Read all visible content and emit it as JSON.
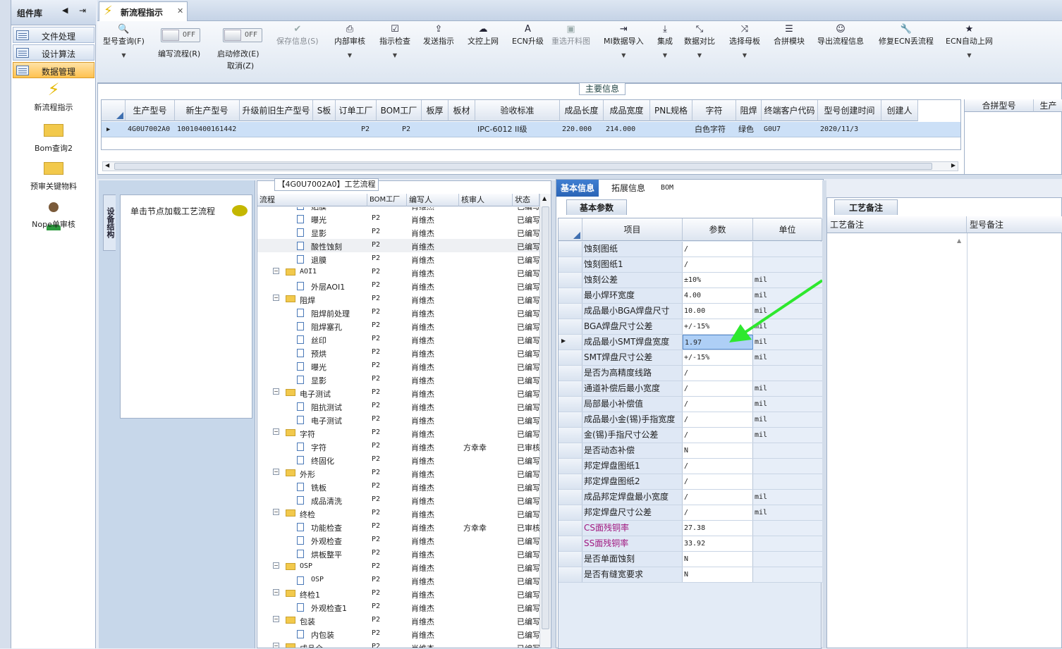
{
  "sidebar": {
    "title": "组件库",
    "groups": [
      "文件处理",
      "设计算法",
      "数据管理"
    ],
    "tools": [
      "新流程指示",
      "Bom查询2",
      "预审关键物料",
      "Nope单审核"
    ]
  },
  "doc_tab": {
    "title": "新流程指示"
  },
  "ribbon": {
    "model_query": "型号查询(F)",
    "toggle1_state": "OFF",
    "toggle1_label": "编写流程(R)",
    "toggle2_state": "OFF",
    "toggle2_label": "启动修改(E)",
    "cancel_label": "取消(Z)",
    "buttons": [
      "保存信息(S)",
      "内部审核",
      "指示检查",
      "发送指示",
      "文控上网",
      "ECN升级",
      "重选开料图",
      "MI数据导入",
      "集成",
      "数据对比",
      "选择母板",
      "合拼模块",
      "导出流程信息",
      "修复ECN丢流程",
      "ECN自动上网"
    ]
  },
  "main_info": {
    "caption": "主要信息",
    "columns": [
      "生产型号",
      "新生产型号",
      "升级前旧生产型号",
      "S板",
      "订单工厂",
      "BOM工厂",
      "板厚",
      "板材",
      "验收标准",
      "成品长度",
      "成品宽度",
      "PNL规格",
      "字符",
      "阻焊",
      "终端客户代码",
      "型号创建时间",
      "创建人"
    ],
    "row": {
      "生产型号": "4G0U7002A0",
      "新生产型号": "10010400161442",
      "订单工厂": "P2",
      "BOM工厂": "P2",
      "验收标准": "IPC-6012 II级",
      "成品长度": "220.000",
      "成品宽度": "214.000",
      "字符": "白色字符",
      "阻焊": "绿色",
      "终端客户代码": "G0U7",
      "型号创建时间": "2020/11/3"
    },
    "side_columns": [
      "合拼型号",
      "生产"
    ]
  },
  "tree_panel": {
    "vtab": "设备结构",
    "hint": "单击节点加载工艺流程"
  },
  "process": {
    "caption": "【4G0U7002A0】工艺流程",
    "columns": [
      "流程",
      "BOM工厂",
      "编写人",
      "核审人",
      "状态"
    ],
    "rows": [
      {
        "n": "贴膜",
        "t": "doc",
        "f": "P2",
        "w": "肖维杰",
        "r": "",
        "s": "已编写"
      },
      {
        "n": "曝光",
        "t": "doc",
        "f": "P2",
        "w": "肖维杰",
        "r": "",
        "s": "已编写"
      },
      {
        "n": "显影",
        "t": "doc",
        "f": "P2",
        "w": "肖维杰",
        "r": "",
        "s": "已编写"
      },
      {
        "n": "酸性蚀刻",
        "t": "doc",
        "f": "P2",
        "w": "肖维杰",
        "r": "",
        "s": "已编写"
      },
      {
        "n": "退膜",
        "t": "doc",
        "f": "P2",
        "w": "肖维杰",
        "r": "",
        "s": "已编写"
      },
      {
        "n": "AOI1",
        "t": "fold",
        "f": "P2",
        "w": "肖维杰",
        "r": "",
        "s": "已编写"
      },
      {
        "n": "外层AOI1",
        "t": "doc",
        "f": "P2",
        "w": "肖维杰",
        "r": "",
        "s": "已编写"
      },
      {
        "n": "阻焊",
        "t": "fold",
        "f": "P2",
        "w": "肖维杰",
        "r": "",
        "s": "已编写"
      },
      {
        "n": "阻焊前处理",
        "t": "doc",
        "f": "P2",
        "w": "肖维杰",
        "r": "",
        "s": "已编写"
      },
      {
        "n": "阻焊塞孔",
        "t": "doc",
        "f": "P2",
        "w": "肖维杰",
        "r": "",
        "s": "已编写"
      },
      {
        "n": "丝印",
        "t": "doc",
        "f": "P2",
        "w": "肖维杰",
        "r": "",
        "s": "已编写"
      },
      {
        "n": "预烘",
        "t": "doc",
        "f": "P2",
        "w": "肖维杰",
        "r": "",
        "s": "已编写"
      },
      {
        "n": "曝光",
        "t": "doc",
        "f": "P2",
        "w": "肖维杰",
        "r": "",
        "s": "已编写"
      },
      {
        "n": "显影",
        "t": "doc",
        "f": "P2",
        "w": "肖维杰",
        "r": "",
        "s": "已编写"
      },
      {
        "n": "电子测试",
        "t": "fold",
        "f": "P2",
        "w": "肖维杰",
        "r": "",
        "s": "已编写"
      },
      {
        "n": "阻抗测试",
        "t": "doc",
        "f": "P2",
        "w": "肖维杰",
        "r": "",
        "s": "已编写"
      },
      {
        "n": "电子测试",
        "t": "doc",
        "f": "P2",
        "w": "肖维杰",
        "r": "",
        "s": "已编写"
      },
      {
        "n": "字符",
        "t": "fold",
        "f": "P2",
        "w": "肖维杰",
        "r": "",
        "s": "已编写"
      },
      {
        "n": "字符",
        "t": "doc",
        "f": "P2",
        "w": "肖维杰",
        "r": "方幸幸",
        "s": "已审核"
      },
      {
        "n": "终固化",
        "t": "doc",
        "f": "P2",
        "w": "肖维杰",
        "r": "",
        "s": "已编写"
      },
      {
        "n": "外形",
        "t": "fold",
        "f": "P2",
        "w": "肖维杰",
        "r": "",
        "s": "已编写"
      },
      {
        "n": "铣板",
        "t": "doc",
        "f": "P2",
        "w": "肖维杰",
        "r": "",
        "s": "已编写"
      },
      {
        "n": "成品清洗",
        "t": "doc",
        "f": "P2",
        "w": "肖维杰",
        "r": "",
        "s": "已编写"
      },
      {
        "n": "终检",
        "t": "fold",
        "f": "P2",
        "w": "肖维杰",
        "r": "",
        "s": "已编写"
      },
      {
        "n": "功能检查",
        "t": "doc",
        "f": "P2",
        "w": "肖维杰",
        "r": "方幸幸",
        "s": "已审核"
      },
      {
        "n": "外观检查",
        "t": "doc",
        "f": "P2",
        "w": "肖维杰",
        "r": "",
        "s": "已编写"
      },
      {
        "n": "烘板整平",
        "t": "doc",
        "f": "P2",
        "w": "肖维杰",
        "r": "",
        "s": "已编写"
      },
      {
        "n": "OSP",
        "t": "fold",
        "f": "P2",
        "w": "肖维杰",
        "r": "",
        "s": "已编写"
      },
      {
        "n": "OSP",
        "t": "doc",
        "f": "P2",
        "w": "肖维杰",
        "r": "",
        "s": "已编写"
      },
      {
        "n": "终检1",
        "t": "fold",
        "f": "P2",
        "w": "肖维杰",
        "r": "",
        "s": "已编写"
      },
      {
        "n": "外观检查1",
        "t": "doc",
        "f": "P2",
        "w": "肖维杰",
        "r": "",
        "s": "已编写"
      },
      {
        "n": "包装",
        "t": "fold",
        "f": "P2",
        "w": "肖维杰",
        "r": "",
        "s": "已编写"
      },
      {
        "n": "内包装",
        "t": "doc",
        "f": "P2",
        "w": "肖维杰",
        "r": "",
        "s": "已编写"
      },
      {
        "n": "成品仓",
        "t": "fold",
        "f": "P2",
        "w": "肖维杰",
        "r": "",
        "s": "已编写"
      }
    ]
  },
  "info": {
    "tabs": [
      "基本信息",
      "拓展信息",
      "BOM"
    ],
    "subtab": "基本参数",
    "columns": [
      "项目",
      "参数",
      "单位"
    ],
    "rows": [
      {
        "k": "蚀刻图纸",
        "v": "/",
        "u": ""
      },
      {
        "k": "蚀刻图纸1",
        "v": "/",
        "u": ""
      },
      {
        "k": "蚀刻公差",
        "v": "±10%",
        "u": "mil"
      },
      {
        "k": "最小焊环宽度",
        "v": "4.00",
        "u": "mil"
      },
      {
        "k": "成品最小BGA焊盘尺寸",
        "v": "10.00",
        "u": "mil"
      },
      {
        "k": "BGA焊盘尺寸公差",
        "v": "+/-15%",
        "u": "mil"
      },
      {
        "k": "成品最小SMT焊盘宽度",
        "v": "1.97",
        "u": "mil"
      },
      {
        "k": "SMT焊盘尺寸公差",
        "v": "+/-15%",
        "u": "mil"
      },
      {
        "k": "是否为高精度线路",
        "v": "/",
        "u": ""
      },
      {
        "k": "通道补偿后最小宽度",
        "v": "/",
        "u": "mil"
      },
      {
        "k": "局部最小补偿值",
        "v": "/",
        "u": "mil"
      },
      {
        "k": "成品最小金(锡)手指宽度",
        "v": "/",
        "u": "mil"
      },
      {
        "k": "金(锡)手指尺寸公差",
        "v": "/",
        "u": "mil"
      },
      {
        "k": "是否动态补偿",
        "v": "N",
        "u": ""
      },
      {
        "k": "邦定焊盘图纸1",
        "v": "/",
        "u": ""
      },
      {
        "k": "邦定焊盘图纸2",
        "v": "/",
        "u": ""
      },
      {
        "k": "成品邦定焊盘最小宽度",
        "v": "/",
        "u": "mil"
      },
      {
        "k": "邦定焊盘尺寸公差",
        "v": "/",
        "u": "mil"
      },
      {
        "k": "CS面残铜率",
        "v": "27.38",
        "u": "",
        "mag": true
      },
      {
        "k": "SS面残铜率",
        "v": "33.92",
        "u": "",
        "mag": true
      },
      {
        "k": "是否单面蚀刻",
        "v": "N",
        "u": ""
      },
      {
        "k": "是否有缝宽要求",
        "v": "N",
        "u": ""
      }
    ]
  },
  "notes": {
    "tab": "工艺备注",
    "columns": [
      "工艺备注",
      "型号备注"
    ]
  },
  "colors": {
    "arrow": "#2ee82e",
    "selected": "#aecff6",
    "accent": "#2a64b6"
  }
}
